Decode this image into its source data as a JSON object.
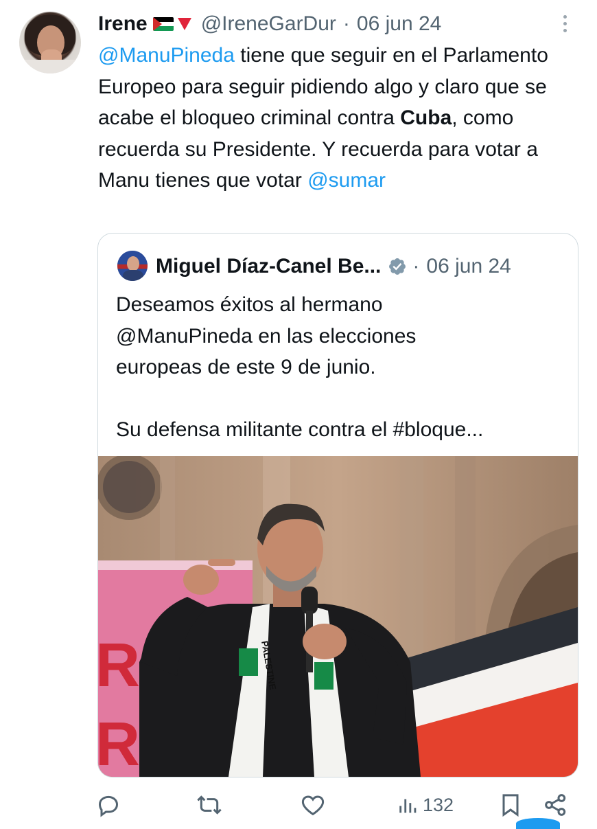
{
  "tweet": {
    "author_name": "Irene",
    "author_handle": "@IreneGarDur",
    "separator": "·",
    "date": "06 jun 24",
    "text_parts": [
      {
        "t": "@ManuPineda",
        "kind": "mention"
      },
      {
        "t": " tiene que seguir en el Parlamento Europeo para seguir pidiendo algo y claro que se acabe el bloqueo criminal contra ",
        "kind": "plain"
      },
      {
        "t": "Cuba",
        "kind": "bold"
      },
      {
        "t": ", como recuerda su Presidente. Y recuerda para votar a Manu tienes que votar ",
        "kind": "plain"
      },
      {
        "t": "@sumar",
        "kind": "mention"
      }
    ]
  },
  "quote": {
    "author_name": "Miguel Díaz-Canel Be...",
    "separator": "·",
    "date": "06 jun 24",
    "text": "Deseamos éxitos al hermano\n@ManuPineda en las elecciones\neuropeas de este 9 de junio.\n\nSu defensa militante contra el #bloque...",
    "photo_banner_text": "PALESTINE"
  },
  "actions": {
    "views_count": "132"
  },
  "colors": {
    "accent": "#1d9bf0",
    "muted": "#536471",
    "border": "#cfd9de",
    "verified": "#829aab"
  }
}
